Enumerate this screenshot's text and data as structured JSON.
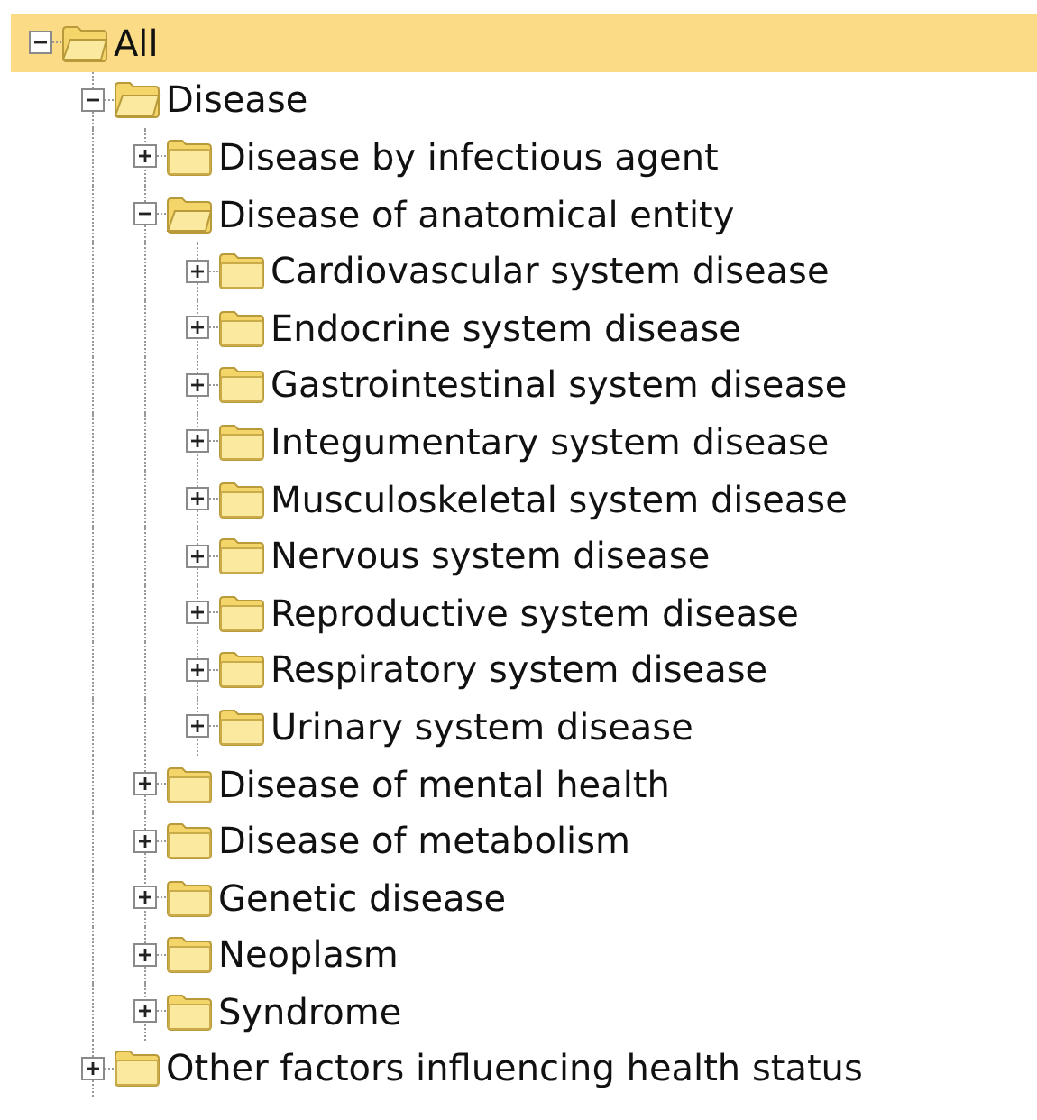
{
  "tree": [
    {
      "label": "All",
      "selected": true,
      "expanded": true,
      "children": [
        {
          "label": "Disease",
          "selected": false,
          "expanded": true,
          "children": [
            {
              "label": "Disease by infectious agent",
              "selected": false,
              "expanded": false
            },
            {
              "label": "Disease of anatomical entity",
              "selected": false,
              "expanded": true,
              "children": [
                {
                  "label": "Cardiovascular system disease",
                  "selected": false,
                  "expanded": false
                },
                {
                  "label": "Endocrine system disease",
                  "selected": false,
                  "expanded": false
                },
                {
                  "label": "Gastrointestinal system disease",
                  "selected": false,
                  "expanded": false
                },
                {
                  "label": "Integumentary system disease",
                  "selected": false,
                  "expanded": false
                },
                {
                  "label": "Musculoskeletal system disease",
                  "selected": false,
                  "expanded": false
                },
                {
                  "label": "Nervous system disease",
                  "selected": false,
                  "expanded": false
                },
                {
                  "label": "Reproductive system disease",
                  "selected": false,
                  "expanded": false
                },
                {
                  "label": "Respiratory system disease",
                  "selected": false,
                  "expanded": false
                },
                {
                  "label": "Urinary system disease",
                  "selected": false,
                  "expanded": false
                }
              ]
            },
            {
              "label": "Disease of mental health",
              "selected": false,
              "expanded": false
            },
            {
              "label": "Disease of metabolism",
              "selected": false,
              "expanded": false
            },
            {
              "label": "Genetic disease",
              "selected": false,
              "expanded": false
            },
            {
              "label": "Neoplasm",
              "selected": false,
              "expanded": false
            },
            {
              "label": "Syndrome",
              "selected": false,
              "expanded": false
            }
          ]
        },
        {
          "label": "Other factors influencing health status",
          "selected": false,
          "expanded": false
        }
      ]
    }
  ]
}
